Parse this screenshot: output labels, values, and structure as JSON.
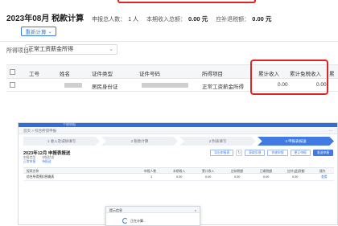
{
  "top": {
    "title": "2023年08月 税款计算",
    "declare_count_label": "申报总人数：",
    "declare_count_value": "1 人",
    "income_total_label": "本期收入总额：",
    "income_total_value": "0.00 元",
    "tax_label": "应补退税额：",
    "tax_value": "0.00 元",
    "recalc_button": "重新计算",
    "filter_label": "所得项目：",
    "filter_value": "正常工资薪金所得",
    "columns": [
      "工号",
      "姓名",
      "证件类型",
      "证件号码",
      "所得项目",
      "累计收入",
      "累计免税收入",
      "累"
    ],
    "row": {
      "emp_no": "",
      "cert_type": "居民身份证",
      "income_item": "正常工资薪金所得",
      "cum_income": "0.00",
      "cum_taxfree": "0.00"
    }
  },
  "bottom": {
    "top_strip_text": "个税申报",
    "breadcrumb": "首页 > 综合所得申报",
    "steps": [
      "1 收入及减除填写",
      "2 税款计算",
      "3 附表填写",
      "4 申报表报送"
    ],
    "active_step": 3,
    "title": "2023年12月 申报表报送",
    "meta": [
      {
        "key": "申报类型",
        "value": "正常申报"
      },
      {
        "key": "申报状态",
        "value": "待报送"
      }
    ],
    "buttons": [
      "导出申报表",
      "获取反馈",
      "作废申报",
      "更正申报",
      "发送申报"
    ],
    "columns": [
      "报表名称",
      "申报人数",
      "本期收入",
      "累计收入",
      "应纳税额",
      "已缴税额",
      "应补(退)税额",
      "操作"
    ],
    "row": [
      "综合所得预扣预缴表",
      "1",
      "0.00",
      "0.00",
      "0.00",
      "0.00",
      "0.00",
      "查看"
    ],
    "modal_title": "提示信息",
    "modal_message": "正在计算..."
  }
}
